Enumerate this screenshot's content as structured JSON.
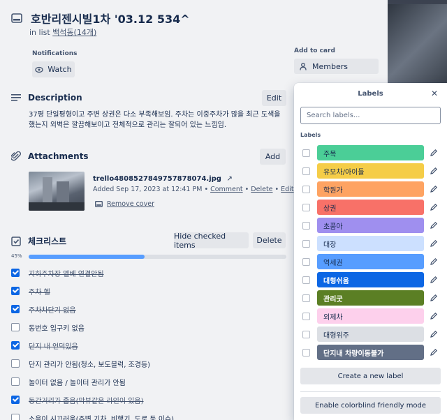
{
  "card": {
    "title": "호반리젠시빌1차     '03.12      534^",
    "in_list_prefix": "in list",
    "list_name": "백석동(14개)"
  },
  "notifications": {
    "label": "Notifications",
    "watch_label": "Watch"
  },
  "description": {
    "heading": "Description",
    "edit_label": "Edit",
    "text": "37평 단일평형이고 주변 상권은 다소 부족해보임. 주차는 이중주차가 많을 최근 도색을 했는지 외벽은 깔끔해보이고 전체적으로 관리는 잘되어 있는 느낌임."
  },
  "attachments": {
    "heading": "Attachments",
    "add_label": "Add",
    "file_name": "trello4808527849757878074.jpg",
    "added_text": "Added Sep 17, 2023 at 12:41 PM",
    "comment_label": "Comment",
    "delete_label": "Delete",
    "edit_label": "Edit",
    "remove_cover_label": "Remove cover"
  },
  "checklist": {
    "heading": "체크리스트",
    "hide_label": "Hide checked items",
    "delete_label": "Delete",
    "percent_label": "45%",
    "progress": 0.45,
    "items": [
      {
        "text": "지하주차장 엘베 연결안됨",
        "checked": true
      },
      {
        "text": "주차 헬",
        "checked": true
      },
      {
        "text": "주차차단기 없음",
        "checked": true
      },
      {
        "text": "동번호 입구키 없음",
        "checked": false
      },
      {
        "text": "단지 내 언덕있음",
        "checked": true
      },
      {
        "text": "단지 관리가 안됨(청소, 보도블럭, 조경등)",
        "checked": false
      },
      {
        "text": "놀이터 없음 / 놀이터 관리가 안됨",
        "checked": false
      },
      {
        "text": "동간거리가 좁음(막뷰같은 라인이 있음)",
        "checked": true
      },
      {
        "text": "소음이 시끄러움(주변 기차, 비행기, 도로 등 이슈)",
        "checked": false
      }
    ]
  },
  "add_to_card": {
    "label": "Add to card",
    "members_label": "Members"
  },
  "labels_popover": {
    "title": "Labels",
    "search_placeholder": "Search labels...",
    "section_label": "Labels",
    "items": [
      {
        "name": "주목",
        "color": "#4bce97",
        "dark": false
      },
      {
        "name": "유모차/아이들",
        "color": "#f5cd47",
        "dark": false
      },
      {
        "name": "학원가",
        "color": "#fea362",
        "dark": false
      },
      {
        "name": "상권",
        "color": "#f87168",
        "dark": false
      },
      {
        "name": "초품아",
        "color": "#9f8fef",
        "dark": false
      },
      {
        "name": "대장",
        "color": "#cce0ff",
        "dark": false
      },
      {
        "name": "역세권",
        "color": "#579dff",
        "dark": false
      },
      {
        "name": "대형쉬움",
        "color": "#0c66e4",
        "dark": true
      },
      {
        "name": "관리굿",
        "color": "#5b7f24",
        "dark": true
      },
      {
        "name": "외제차",
        "color": "#fdd0ec",
        "dark": false
      },
      {
        "name": "대형위주",
        "color": "#dcdfe4",
        "dark": false
      },
      {
        "name": "단지내 차량이동불가",
        "color": "#626f86",
        "dark": true
      }
    ],
    "create_label": "Create a new label",
    "colorblind_label": "Enable colorblind friendly mode"
  }
}
